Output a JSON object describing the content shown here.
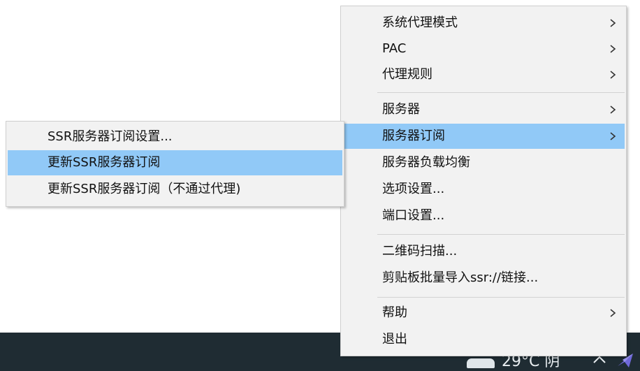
{
  "main_menu": {
    "items": [
      {
        "label": "系统代理模式",
        "has_submenu": true
      },
      {
        "label": "PAC",
        "has_submenu": true
      },
      {
        "label": "代理规则",
        "has_submenu": true
      },
      {
        "label": "服务器",
        "has_submenu": true
      },
      {
        "label": "服务器订阅",
        "has_submenu": true,
        "highlighted": true
      },
      {
        "label": "服务器负载均衡",
        "has_submenu": false
      },
      {
        "label": "选项设置...",
        "has_submenu": false
      },
      {
        "label": "端口设置...",
        "has_submenu": false
      },
      {
        "label": "二维码扫描...",
        "has_submenu": false
      },
      {
        "label": "剪贴板批量导入ssr://链接...",
        "has_submenu": false
      },
      {
        "label": "帮助",
        "has_submenu": true
      },
      {
        "label": "退出",
        "has_submenu": false
      }
    ]
  },
  "submenu": {
    "items": [
      {
        "label": "SSR服务器订阅设置..."
      },
      {
        "label": "更新SSR服务器订阅",
        "highlighted": true
      },
      {
        "label": "更新SSR服务器订阅（不通过代理)"
      }
    ]
  },
  "taskbar": {
    "weather_text": "29°C 阴"
  },
  "colors": {
    "menu_background": "#f2f2f2",
    "highlight": "#91c9f7",
    "taskbar": "#1f2c33"
  }
}
